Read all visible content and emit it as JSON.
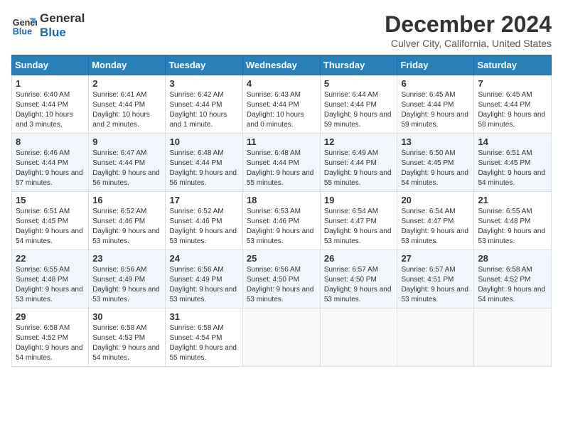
{
  "logo": {
    "line1": "General",
    "line2": "Blue"
  },
  "title": "December 2024",
  "location": "Culver City, California, United States",
  "days_of_week": [
    "Sunday",
    "Monday",
    "Tuesday",
    "Wednesday",
    "Thursday",
    "Friday",
    "Saturday"
  ],
  "weeks": [
    [
      {
        "day": "1",
        "sunrise": "Sunrise: 6:40 AM",
        "sunset": "Sunset: 4:44 PM",
        "daylight": "Daylight: 10 hours and 3 minutes."
      },
      {
        "day": "2",
        "sunrise": "Sunrise: 6:41 AM",
        "sunset": "Sunset: 4:44 PM",
        "daylight": "Daylight: 10 hours and 2 minutes."
      },
      {
        "day": "3",
        "sunrise": "Sunrise: 6:42 AM",
        "sunset": "Sunset: 4:44 PM",
        "daylight": "Daylight: 10 hours and 1 minute."
      },
      {
        "day": "4",
        "sunrise": "Sunrise: 6:43 AM",
        "sunset": "Sunset: 4:44 PM",
        "daylight": "Daylight: 10 hours and 0 minutes."
      },
      {
        "day": "5",
        "sunrise": "Sunrise: 6:44 AM",
        "sunset": "Sunset: 4:44 PM",
        "daylight": "Daylight: 9 hours and 59 minutes."
      },
      {
        "day": "6",
        "sunrise": "Sunrise: 6:45 AM",
        "sunset": "Sunset: 4:44 PM",
        "daylight": "Daylight: 9 hours and 59 minutes."
      },
      {
        "day": "7",
        "sunrise": "Sunrise: 6:45 AM",
        "sunset": "Sunset: 4:44 PM",
        "daylight": "Daylight: 9 hours and 58 minutes."
      }
    ],
    [
      {
        "day": "8",
        "sunrise": "Sunrise: 6:46 AM",
        "sunset": "Sunset: 4:44 PM",
        "daylight": "Daylight: 9 hours and 57 minutes."
      },
      {
        "day": "9",
        "sunrise": "Sunrise: 6:47 AM",
        "sunset": "Sunset: 4:44 PM",
        "daylight": "Daylight: 9 hours and 56 minutes."
      },
      {
        "day": "10",
        "sunrise": "Sunrise: 6:48 AM",
        "sunset": "Sunset: 4:44 PM",
        "daylight": "Daylight: 9 hours and 56 minutes."
      },
      {
        "day": "11",
        "sunrise": "Sunrise: 6:48 AM",
        "sunset": "Sunset: 4:44 PM",
        "daylight": "Daylight: 9 hours and 55 minutes."
      },
      {
        "day": "12",
        "sunrise": "Sunrise: 6:49 AM",
        "sunset": "Sunset: 4:44 PM",
        "daylight": "Daylight: 9 hours and 55 minutes."
      },
      {
        "day": "13",
        "sunrise": "Sunrise: 6:50 AM",
        "sunset": "Sunset: 4:45 PM",
        "daylight": "Daylight: 9 hours and 54 minutes."
      },
      {
        "day": "14",
        "sunrise": "Sunrise: 6:51 AM",
        "sunset": "Sunset: 4:45 PM",
        "daylight": "Daylight: 9 hours and 54 minutes."
      }
    ],
    [
      {
        "day": "15",
        "sunrise": "Sunrise: 6:51 AM",
        "sunset": "Sunset: 4:45 PM",
        "daylight": "Daylight: 9 hours and 54 minutes."
      },
      {
        "day": "16",
        "sunrise": "Sunrise: 6:52 AM",
        "sunset": "Sunset: 4:46 PM",
        "daylight": "Daylight: 9 hours and 53 minutes."
      },
      {
        "day": "17",
        "sunrise": "Sunrise: 6:52 AM",
        "sunset": "Sunset: 4:46 PM",
        "daylight": "Daylight: 9 hours and 53 minutes."
      },
      {
        "day": "18",
        "sunrise": "Sunrise: 6:53 AM",
        "sunset": "Sunset: 4:46 PM",
        "daylight": "Daylight: 9 hours and 53 minutes."
      },
      {
        "day": "19",
        "sunrise": "Sunrise: 6:54 AM",
        "sunset": "Sunset: 4:47 PM",
        "daylight": "Daylight: 9 hours and 53 minutes."
      },
      {
        "day": "20",
        "sunrise": "Sunrise: 6:54 AM",
        "sunset": "Sunset: 4:47 PM",
        "daylight": "Daylight: 9 hours and 53 minutes."
      },
      {
        "day": "21",
        "sunrise": "Sunrise: 6:55 AM",
        "sunset": "Sunset: 4:48 PM",
        "daylight": "Daylight: 9 hours and 53 minutes."
      }
    ],
    [
      {
        "day": "22",
        "sunrise": "Sunrise: 6:55 AM",
        "sunset": "Sunset: 4:48 PM",
        "daylight": "Daylight: 9 hours and 53 minutes."
      },
      {
        "day": "23",
        "sunrise": "Sunrise: 6:56 AM",
        "sunset": "Sunset: 4:49 PM",
        "daylight": "Daylight: 9 hours and 53 minutes."
      },
      {
        "day": "24",
        "sunrise": "Sunrise: 6:56 AM",
        "sunset": "Sunset: 4:49 PM",
        "daylight": "Daylight: 9 hours and 53 minutes."
      },
      {
        "day": "25",
        "sunrise": "Sunrise: 6:56 AM",
        "sunset": "Sunset: 4:50 PM",
        "daylight": "Daylight: 9 hours and 53 minutes."
      },
      {
        "day": "26",
        "sunrise": "Sunrise: 6:57 AM",
        "sunset": "Sunset: 4:50 PM",
        "daylight": "Daylight: 9 hours and 53 minutes."
      },
      {
        "day": "27",
        "sunrise": "Sunrise: 6:57 AM",
        "sunset": "Sunset: 4:51 PM",
        "daylight": "Daylight: 9 hours and 53 minutes."
      },
      {
        "day": "28",
        "sunrise": "Sunrise: 6:58 AM",
        "sunset": "Sunset: 4:52 PM",
        "daylight": "Daylight: 9 hours and 54 minutes."
      }
    ],
    [
      {
        "day": "29",
        "sunrise": "Sunrise: 6:58 AM",
        "sunset": "Sunset: 4:52 PM",
        "daylight": "Daylight: 9 hours and 54 minutes."
      },
      {
        "day": "30",
        "sunrise": "Sunrise: 6:58 AM",
        "sunset": "Sunset: 4:53 PM",
        "daylight": "Daylight: 9 hours and 54 minutes."
      },
      {
        "day": "31",
        "sunrise": "Sunrise: 6:58 AM",
        "sunset": "Sunset: 4:54 PM",
        "daylight": "Daylight: 9 hours and 55 minutes."
      },
      null,
      null,
      null,
      null
    ]
  ]
}
